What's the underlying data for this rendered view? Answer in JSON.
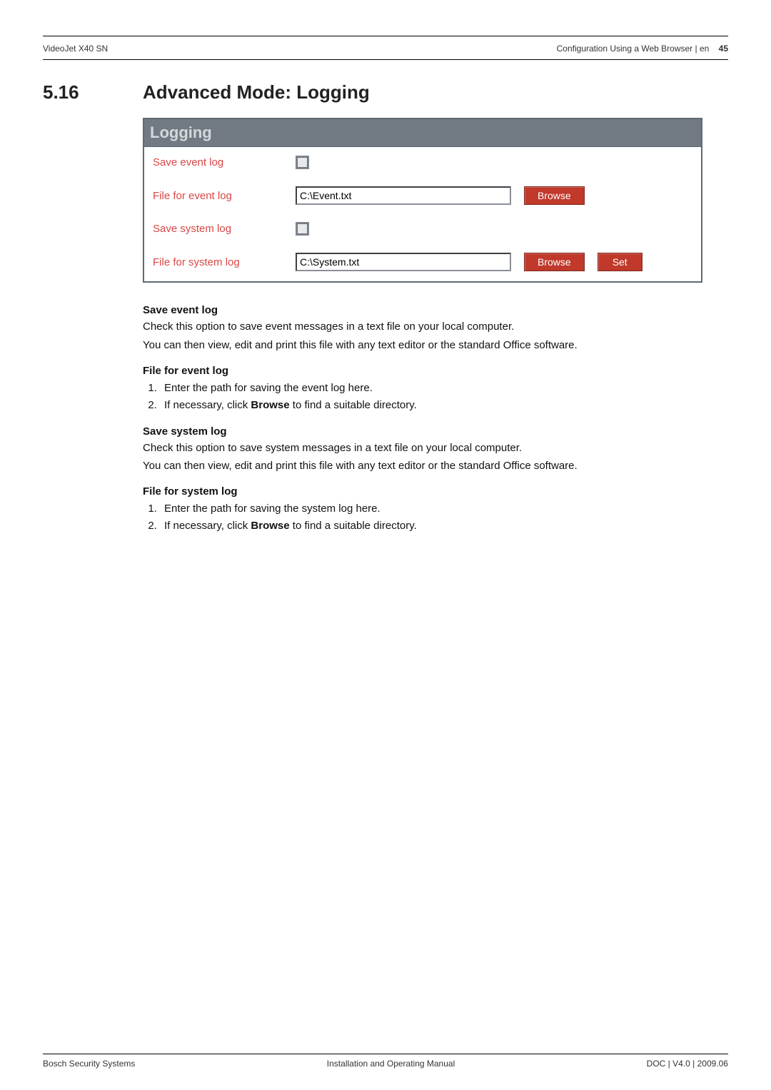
{
  "header": {
    "left": "VideoJet X40 SN",
    "right_text": "Configuration Using a Web Browser | en",
    "page_number": "45"
  },
  "section": {
    "number": "5.16",
    "title": "Advanced Mode: Logging"
  },
  "panel": {
    "title": "Logging",
    "rows": {
      "save_event_log": "Save event log",
      "file_event_log": "File for event log",
      "file_event_value": "C:\\Event.txt",
      "save_system_log": "Save system log",
      "file_system_log": "File for system log",
      "file_system_value": "C:\\System.txt",
      "browse": "Browse",
      "set": "Set"
    }
  },
  "body": {
    "save_event_head": "Save event log",
    "save_event_p1": "Check this option to save event messages in a text file on your local computer.",
    "save_event_p2": "You can then view, edit and print this file with any text editor or the standard Office software.",
    "file_event_head": "File for event log",
    "file_event_li1": "Enter the path for saving the event log here.",
    "file_event_li2_a": "If necessary, click ",
    "file_event_li2_b": "Browse",
    "file_event_li2_c": " to find a suitable directory.",
    "save_system_head": "Save system log",
    "save_system_p1": "Check this option to save system messages in a text file on your local computer.",
    "save_system_p2": "You can then view, edit and print this file with any text editor or the standard Office software.",
    "file_system_head": "File for system log",
    "file_system_li1": "Enter the path for saving the system log here.",
    "file_system_li2_a": "If necessary, click ",
    "file_system_li2_b": "Browse",
    "file_system_li2_c": " to find a suitable directory."
  },
  "footer": {
    "left": "Bosch Security Systems",
    "center": "Installation and Operating Manual",
    "right": "DOC | V4.0 | 2009.06"
  }
}
